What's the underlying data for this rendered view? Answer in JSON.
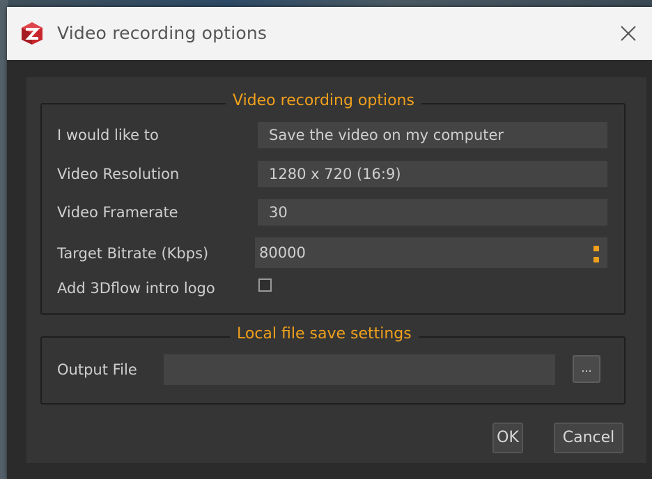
{
  "window": {
    "title": "Video recording options",
    "app_icon": "3dflow-logo-icon",
    "close_icon": "close-icon"
  },
  "recording_group": {
    "title": "Video recording options",
    "rows": {
      "action_label": "I would like to",
      "action_value": "Save the video on my computer",
      "resolution_label": "Video Resolution",
      "resolution_value": "1280 x 720 (16:9)",
      "framerate_label": "Video Framerate",
      "framerate_value": "30",
      "bitrate_label": "Target Bitrate (Kbps)",
      "bitrate_value": "80000",
      "intro_logo_label": "Add 3Dflow intro logo",
      "intro_logo_checked": false
    }
  },
  "file_group": {
    "title": "Local file save settings",
    "output_label": "Output File",
    "output_value": "",
    "browse_label": "..."
  },
  "buttons": {
    "ok_label": "OK",
    "cancel_label": "Cancel"
  },
  "colors": {
    "accent": "#f0a01c",
    "background": "#2b2b2b",
    "panel": "#353535",
    "field": "#444444",
    "text": "#cfcfcf"
  }
}
